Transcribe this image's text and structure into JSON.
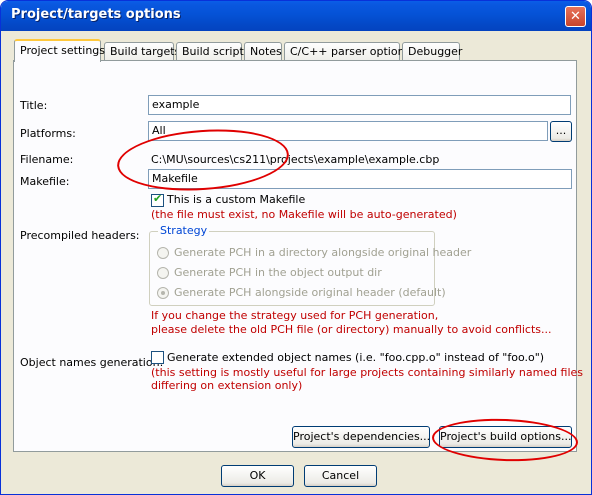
{
  "window": {
    "title": "Project/targets options",
    "close": "✕"
  },
  "tabs": [
    {
      "label": "Project settings"
    },
    {
      "label": "Build targets"
    },
    {
      "label": "Build scripts"
    },
    {
      "label": "Notes"
    },
    {
      "label": "C/C++ parser options"
    },
    {
      "label": "Debugger"
    }
  ],
  "settings": {
    "title_label": "Title:",
    "title_value": "example",
    "platforms_label": "Platforms:",
    "platforms_value": "All",
    "platforms_button": "...",
    "filename_label": "Filename:",
    "filename_value": "C:\\MU\\sources\\cs211\\projects\\example\\example.cbp",
    "makefile_label": "Makefile:",
    "makefile_value": "Makefile",
    "custom_makefile_label": "This is a custom Makefile",
    "custom_makefile_checked": true,
    "custom_makefile_note": "(the file must exist, no Makefile will be auto-generated)",
    "pch_label": "Precompiled headers:",
    "strategy_title": "Strategy",
    "strategy_options": [
      "Generate PCH in a directory alongside original header",
      "Generate PCH in the object output dir",
      "Generate PCH alongside original header (default)"
    ],
    "strategy_selected_index": 2,
    "pch_warning_1": "If you change the strategy used for PCH generation,",
    "pch_warning_2": "please delete the old PCH file (or directory) manually to avoid conflicts...",
    "objnames_label": "Object names generation:",
    "objnames_check_label": "Generate extended object names (i.e. \"foo.cpp.o\" instead of \"foo.o\")",
    "objnames_checked": false,
    "objnames_note_1": "(this setting is mostly useful for large projects containing similarly named files",
    "objnames_note_2": "differing on extension only)",
    "dependencies_button": "Project's dependencies...",
    "build_options_button": "Project's build options..."
  },
  "footer": {
    "ok": "OK",
    "cancel": "Cancel"
  },
  "colors": {
    "annotation": "#e00000",
    "note_text": "#c00000",
    "titlebar": "#0552d6"
  }
}
